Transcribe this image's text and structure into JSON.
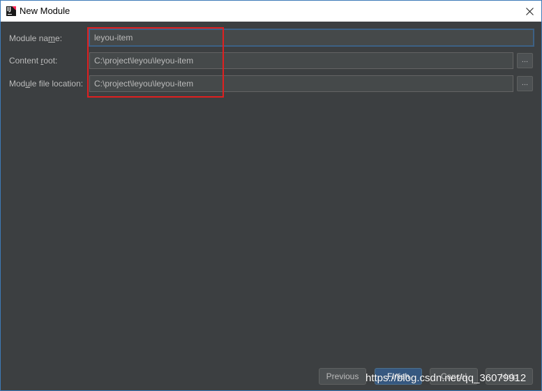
{
  "window": {
    "title": "New Module",
    "icon": "intellij-idea-icon",
    "close_icon": "close-icon"
  },
  "form": {
    "module_name": {
      "label_pre": "Module na",
      "label_mnemonic": "m",
      "label_post": "e:",
      "value": "leyou-item"
    },
    "content_root": {
      "label_pre": "Content ",
      "label_mnemonic": "r",
      "label_post": "oot:",
      "value": "C:\\project\\leyou\\leyou-item",
      "browse_label": "..."
    },
    "module_file_location": {
      "label_pre": "Mod",
      "label_mnemonic": "u",
      "label_post": "le file location:",
      "value": "C:\\project\\leyou\\leyou-item",
      "browse_label": "..."
    }
  },
  "buttons": {
    "previous": "Previous",
    "finish": "Finish",
    "cancel": "Cancel",
    "help": "Help"
  },
  "watermark": "https://blog.csdn.net/qq_36079912",
  "colors": {
    "background": "#3c3f41",
    "field": "#45494a",
    "text": "#bbbbbb",
    "focus_border": "#3d6185",
    "annotation": "#e02020",
    "primary_button": "#365880"
  }
}
